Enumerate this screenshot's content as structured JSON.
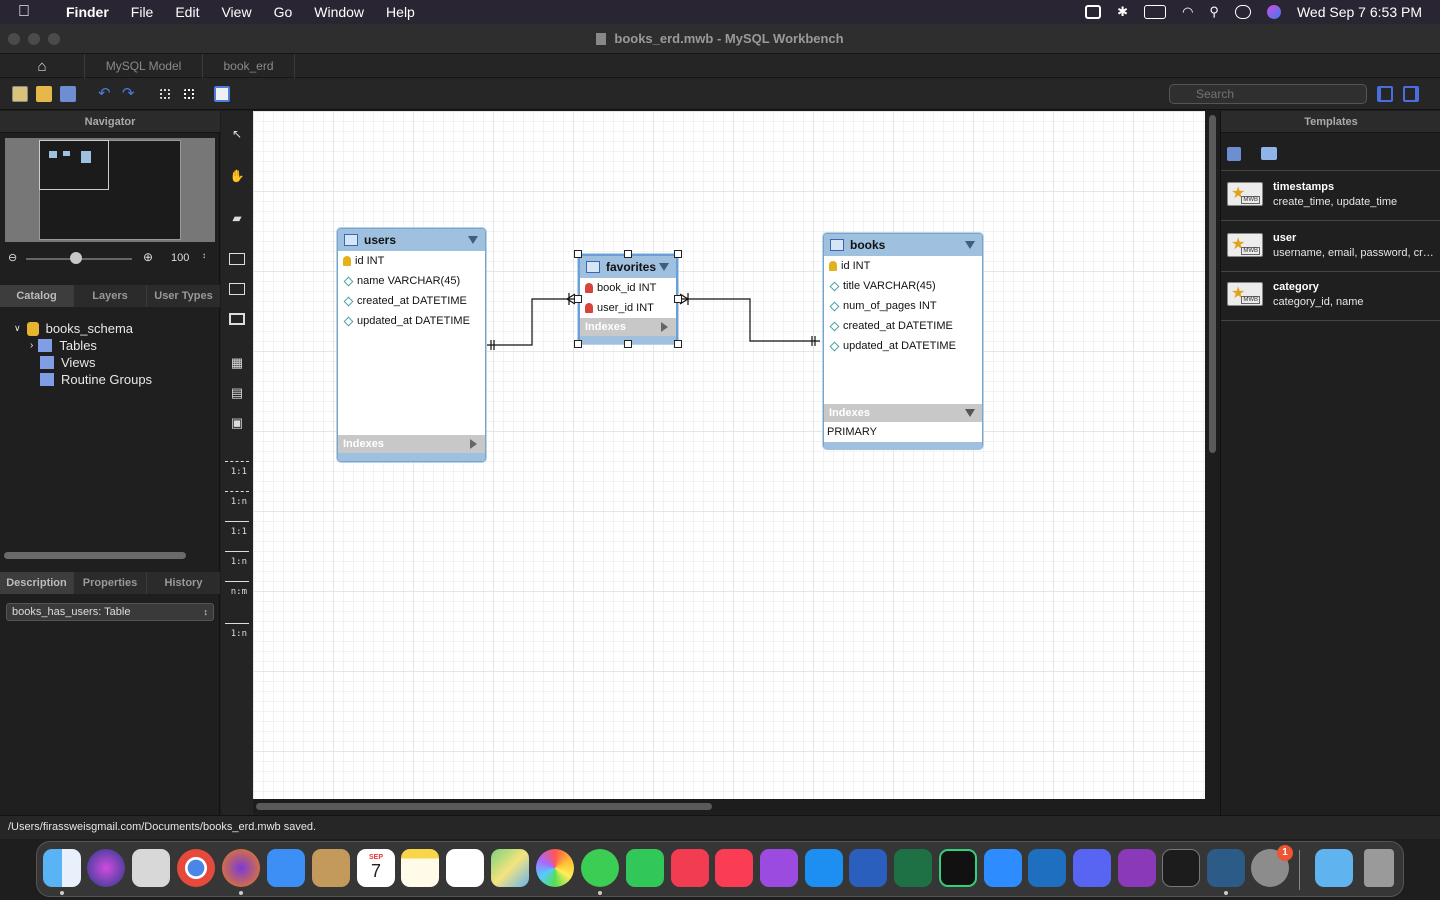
{
  "menubar": {
    "app": "Finder",
    "items": [
      "File",
      "Edit",
      "View",
      "Go",
      "Window",
      "Help"
    ],
    "datetime": "Wed Sep 7  6:53 PM"
  },
  "window": {
    "title": "books_erd.mwb - MySQL Workbench"
  },
  "tabs": [
    {
      "label": "MySQL Model"
    },
    {
      "label": "book_erd"
    }
  ],
  "toolbar": {
    "search_placeholder": "Search"
  },
  "navigator": {
    "title": "Navigator",
    "zoom": "100",
    "segments": [
      "Catalog",
      "Layers",
      "User Types"
    ]
  },
  "tree": {
    "schema": "books_schema",
    "items": [
      "Tables",
      "Views",
      "Routine Groups"
    ]
  },
  "bottom_panel": {
    "segments": [
      "Description",
      "Properties",
      "History"
    ],
    "selected_object": "books_has_users: Table"
  },
  "relationship_tools": [
    "1:1",
    "1:n",
    "1:1",
    "1:n",
    "n:m",
    "1:n"
  ],
  "diagram": {
    "users": {
      "name": "users",
      "columns": [
        "id INT",
        "name VARCHAR(45)",
        "created_at DATETIME",
        "updated_at DATETIME"
      ],
      "indexes_label": "Indexes"
    },
    "favorites": {
      "name": "favorites",
      "columns": [
        "book_id INT",
        "user_id INT"
      ],
      "indexes_label": "Indexes"
    },
    "books": {
      "name": "books",
      "columns": [
        "id INT",
        "title VARCHAR(45)",
        "num_of_pages INT",
        "created_at DATETIME",
        "updated_at DATETIME"
      ],
      "indexes_label": "Indexes",
      "indexes": [
        "PRIMARY"
      ]
    }
  },
  "templates": {
    "title": "Templates",
    "items": [
      {
        "name": "timestamps",
        "desc": "create_time, update_time"
      },
      {
        "name": "user",
        "desc": "username, email, password, cre..."
      },
      {
        "name": "category",
        "desc": "category_id, name"
      }
    ],
    "icon_label": "MWB"
  },
  "status": {
    "message": "/Users/firassweisgmail.com/Documents/books_erd.mwb saved."
  },
  "calendar": {
    "month": "SEP",
    "day": "7"
  },
  "dock_badge": "1"
}
